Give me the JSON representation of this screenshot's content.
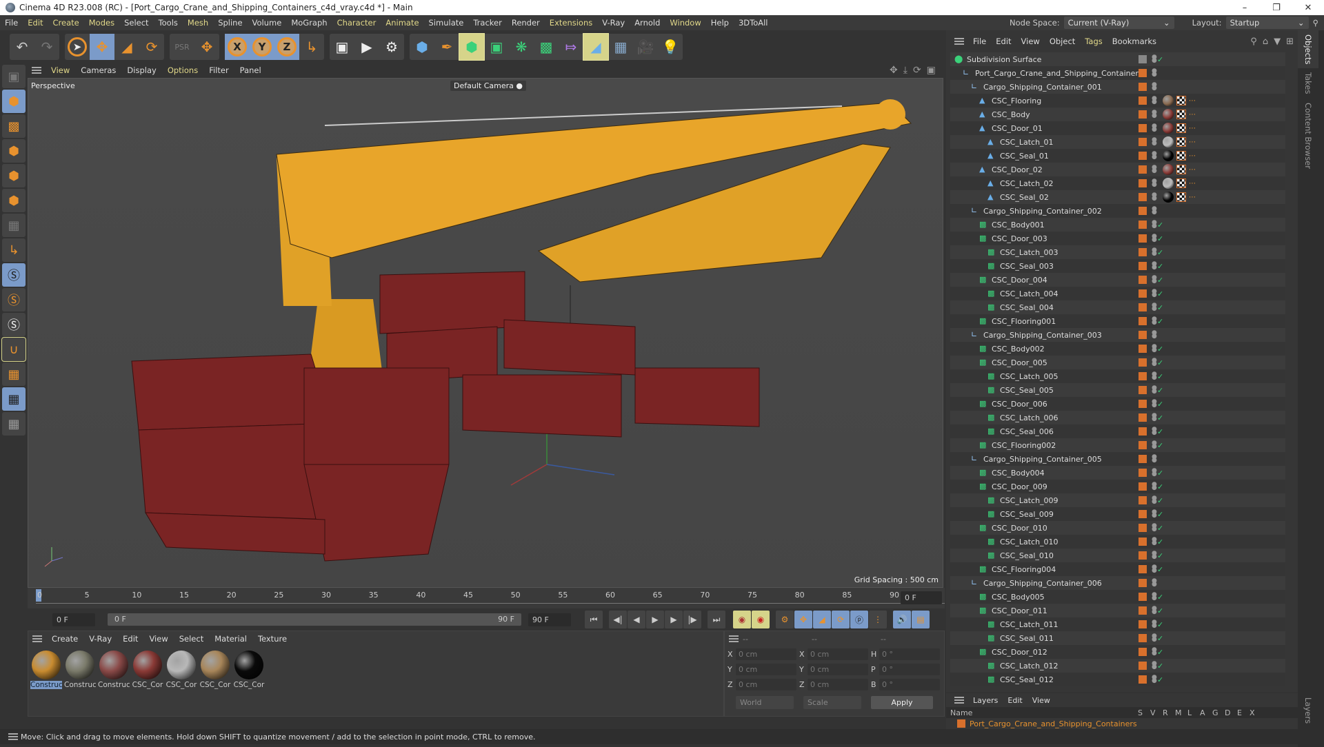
{
  "window": {
    "title": "Cinema 4D R23.008 (RC) - [Port_Cargo_Crane_and_Shipping_Containers_c4d_vray.c4d *] - Main",
    "controls": [
      "minimize-icon",
      "restore-icon",
      "close-icon"
    ]
  },
  "menubar": {
    "items": [
      {
        "label": "File",
        "highlight": false
      },
      {
        "label": "Edit",
        "highlight": true
      },
      {
        "label": "Create",
        "highlight": true
      },
      {
        "label": "Modes",
        "highlight": true
      },
      {
        "label": "Select",
        "highlight": false
      },
      {
        "label": "Tools",
        "highlight": false
      },
      {
        "label": "Mesh",
        "highlight": true
      },
      {
        "label": "Spline",
        "highlight": false
      },
      {
        "label": "Volume",
        "highlight": false
      },
      {
        "label": "MoGraph",
        "highlight": false
      },
      {
        "label": "Character",
        "highlight": true
      },
      {
        "label": "Animate",
        "highlight": true
      },
      {
        "label": "Simulate",
        "highlight": false
      },
      {
        "label": "Tracker",
        "highlight": false
      },
      {
        "label": "Render",
        "highlight": false
      },
      {
        "label": "Extensions",
        "highlight": true
      },
      {
        "label": "V-Ray",
        "highlight": false
      },
      {
        "label": "Arnold",
        "highlight": false
      },
      {
        "label": "Window",
        "highlight": true
      },
      {
        "label": "Help",
        "highlight": false
      },
      {
        "label": "3DToAll",
        "highlight": false
      }
    ],
    "node_space_label": "Node Space:",
    "node_space_value": "Current (V-Ray)",
    "layout_label": "Layout:",
    "layout_value": "Startup"
  },
  "viewport": {
    "menu": [
      {
        "label": "View",
        "highlight": true
      },
      {
        "label": "Cameras",
        "highlight": false
      },
      {
        "label": "Display",
        "highlight": false
      },
      {
        "label": "Options",
        "highlight": true
      },
      {
        "label": "Filter",
        "highlight": false
      },
      {
        "label": "Panel",
        "highlight": false
      }
    ],
    "view_name": "Perspective",
    "camera": "Default Camera",
    "grid_spacing": "Grid Spacing : 500 cm"
  },
  "timeline": {
    "ticks": [
      "0",
      "5",
      "10",
      "15",
      "20",
      "25",
      "30",
      "35",
      "40",
      "45",
      "50",
      "55",
      "60",
      "65",
      "70",
      "75",
      "80",
      "85",
      "90"
    ],
    "current_frame_right": "0 F",
    "start_field": "0 F",
    "range_start": "0 F",
    "range_end": "90 F",
    "end_field": "90 F"
  },
  "materials": {
    "menu": [
      "Create",
      "V-Ray",
      "Edit",
      "View",
      "Select",
      "Material",
      "Texture"
    ],
    "items": [
      {
        "name": "Construc",
        "color": "#c98c30",
        "selected": true
      },
      {
        "name": "Construc",
        "color": "#7a7a6a",
        "selected": false
      },
      {
        "name": "Construc",
        "color": "#8a4a48",
        "selected": false
      },
      {
        "name": "CSC_Cor",
        "color": "#8a3a36",
        "selected": false
      },
      {
        "name": "CSC_Cor",
        "color": "#b8b8b8",
        "selected": false
      },
      {
        "name": "CSC_Cor",
        "color": "#a8865a",
        "selected": false
      },
      {
        "name": "CSC_Cor",
        "color": "#0a0a0a",
        "selected": false
      }
    ]
  },
  "coordinates": {
    "headers": [
      "--",
      "--",
      "--"
    ],
    "rows": [
      {
        "a1": "X",
        "v1": "0 cm",
        "a2": "X",
        "v2": "0 cm",
        "a3": "H",
        "v3": "0 °"
      },
      {
        "a1": "Y",
        "v1": "0 cm",
        "a2": "Y",
        "v2": "0 cm",
        "a3": "P",
        "v3": "0 °"
      },
      {
        "a1": "Z",
        "v1": "0 cm",
        "a2": "Z",
        "v2": "0 cm",
        "a3": "B",
        "v3": "0 °"
      }
    ],
    "mode": "World",
    "transform": "Scale",
    "apply_label": "Apply"
  },
  "objects": {
    "menu": [
      {
        "label": "File",
        "highlight": false
      },
      {
        "label": "Edit",
        "highlight": false
      },
      {
        "label": "View",
        "highlight": false
      },
      {
        "label": "Object",
        "highlight": false
      },
      {
        "label": "Tags",
        "highlight": true
      },
      {
        "label": "Bookmarks",
        "highlight": false
      }
    ],
    "rows": [
      {
        "name": "Subdivision Surface",
        "depth": 0,
        "type": "subdiv",
        "check": true,
        "tags": false
      },
      {
        "name": "Port_Cargo_Crane_and_Shipping_Containers",
        "depth": 1,
        "type": "null",
        "check": false,
        "tags": false
      },
      {
        "name": "Cargo_Shipping_Container_001",
        "depth": 2,
        "type": "null",
        "check": false,
        "tags": false
      },
      {
        "name": "CSC_Flooring",
        "depth": 3,
        "type": "poly",
        "check": false,
        "tags": true,
        "mat": "#8a6a50"
      },
      {
        "name": "CSC_Body",
        "depth": 3,
        "type": "poly",
        "check": false,
        "tags": true,
        "mat": "#8a3a36"
      },
      {
        "name": "CSC_Door_01",
        "depth": 3,
        "type": "poly",
        "check": false,
        "tags": true,
        "mat": "#8a3a36"
      },
      {
        "name": "CSC_Latch_01",
        "depth": 4,
        "type": "poly",
        "check": false,
        "tags": true,
        "mat": "#bbbbbb"
      },
      {
        "name": "CSC_Seal_01",
        "depth": 4,
        "type": "poly",
        "check": false,
        "tags": true,
        "mat": "#050505"
      },
      {
        "name": "CSC_Door_02",
        "depth": 3,
        "type": "poly",
        "check": false,
        "tags": true,
        "mat": "#8a3a36"
      },
      {
        "name": "CSC_Latch_02",
        "depth": 4,
        "type": "poly",
        "check": false,
        "tags": true,
        "mat": "#bbbbbb"
      },
      {
        "name": "CSC_Seal_02",
        "depth": 4,
        "type": "poly",
        "check": false,
        "tags": true,
        "mat": "#050505"
      },
      {
        "name": "Cargo_Shipping_Container_002",
        "depth": 2,
        "type": "null",
        "check": false,
        "tags": false
      },
      {
        "name": "CSC_Body001",
        "depth": 3,
        "type": "inst",
        "check": true,
        "tags": false
      },
      {
        "name": "CSC_Door_003",
        "depth": 3,
        "type": "inst",
        "check": true,
        "tags": false
      },
      {
        "name": "CSC_Latch_003",
        "depth": 4,
        "type": "inst",
        "check": true,
        "tags": false
      },
      {
        "name": "CSC_Seal_003",
        "depth": 4,
        "type": "inst",
        "check": true,
        "tags": false
      },
      {
        "name": "CSC_Door_004",
        "depth": 3,
        "type": "inst",
        "check": true,
        "tags": false
      },
      {
        "name": "CSC_Latch_004",
        "depth": 4,
        "type": "inst",
        "check": true,
        "tags": false
      },
      {
        "name": "CSC_Seal_004",
        "depth": 4,
        "type": "inst",
        "check": true,
        "tags": false
      },
      {
        "name": "CSC_Flooring001",
        "depth": 3,
        "type": "inst",
        "check": true,
        "tags": false
      },
      {
        "name": "Cargo_Shipping_Container_003",
        "depth": 2,
        "type": "null",
        "check": false,
        "tags": false
      },
      {
        "name": "CSC_Body002",
        "depth": 3,
        "type": "inst",
        "check": true,
        "tags": false
      },
      {
        "name": "CSC_Door_005",
        "depth": 3,
        "type": "inst",
        "check": true,
        "tags": false
      },
      {
        "name": "CSC_Latch_005",
        "depth": 4,
        "type": "inst",
        "check": true,
        "tags": false
      },
      {
        "name": "CSC_Seal_005",
        "depth": 4,
        "type": "inst",
        "check": true,
        "tags": false
      },
      {
        "name": "CSC_Door_006",
        "depth": 3,
        "type": "inst",
        "check": true,
        "tags": false
      },
      {
        "name": "CSC_Latch_006",
        "depth": 4,
        "type": "inst",
        "check": true,
        "tags": false
      },
      {
        "name": "CSC_Seal_006",
        "depth": 4,
        "type": "inst",
        "check": true,
        "tags": false
      },
      {
        "name": "CSC_Flooring002",
        "depth": 3,
        "type": "inst",
        "check": true,
        "tags": false
      },
      {
        "name": "Cargo_Shipping_Container_005",
        "depth": 2,
        "type": "null",
        "check": false,
        "tags": false
      },
      {
        "name": "CSC_Body004",
        "depth": 3,
        "type": "inst",
        "check": true,
        "tags": false
      },
      {
        "name": "CSC_Door_009",
        "depth": 3,
        "type": "inst",
        "check": true,
        "tags": false
      },
      {
        "name": "CSC_Latch_009",
        "depth": 4,
        "type": "inst",
        "check": true,
        "tags": false
      },
      {
        "name": "CSC_Seal_009",
        "depth": 4,
        "type": "inst",
        "check": true,
        "tags": false
      },
      {
        "name": "CSC_Door_010",
        "depth": 3,
        "type": "inst",
        "check": true,
        "tags": false
      },
      {
        "name": "CSC_Latch_010",
        "depth": 4,
        "type": "inst",
        "check": true,
        "tags": false
      },
      {
        "name": "CSC_Seal_010",
        "depth": 4,
        "type": "inst",
        "check": true,
        "tags": false
      },
      {
        "name": "CSC_Flooring004",
        "depth": 3,
        "type": "inst",
        "check": true,
        "tags": false
      },
      {
        "name": "Cargo_Shipping_Container_006",
        "depth": 2,
        "type": "null",
        "check": false,
        "tags": false
      },
      {
        "name": "CSC_Body005",
        "depth": 3,
        "type": "inst",
        "check": true,
        "tags": false
      },
      {
        "name": "CSC_Door_011",
        "depth": 3,
        "type": "inst",
        "check": true,
        "tags": false
      },
      {
        "name": "CSC_Latch_011",
        "depth": 4,
        "type": "inst",
        "check": true,
        "tags": false
      },
      {
        "name": "CSC_Seal_011",
        "depth": 4,
        "type": "inst",
        "check": true,
        "tags": false
      },
      {
        "name": "CSC_Door_012",
        "depth": 3,
        "type": "inst",
        "check": true,
        "tags": false
      },
      {
        "name": "CSC_Latch_012",
        "depth": 4,
        "type": "inst",
        "check": true,
        "tags": false
      },
      {
        "name": "CSC_Seal_012",
        "depth": 4,
        "type": "inst",
        "check": true,
        "tags": false
      }
    ]
  },
  "side_tabs": [
    "Objects",
    "Takes",
    "Content Browser"
  ],
  "layers": {
    "menu": [
      "Layers",
      "Edit",
      "View"
    ],
    "columns": [
      "Name",
      "S",
      "V",
      "R",
      "M",
      "L",
      "A",
      "G",
      "D",
      "E",
      "X"
    ],
    "rows": [
      {
        "name": "Port_Cargo_Crane_and_Shipping_Containers",
        "color": "#d8702c"
      }
    ],
    "side_tab": "Layers"
  },
  "status": {
    "text": "Move: Click and drag to move elements. Hold down SHIFT to quantize movement / add to the selection in point mode, CTRL to remove."
  },
  "colors": {
    "accent": "#e8922e",
    "selection": "#7b9bc9",
    "highlight_text": "#e2d98a",
    "layer": "#d8702c"
  }
}
